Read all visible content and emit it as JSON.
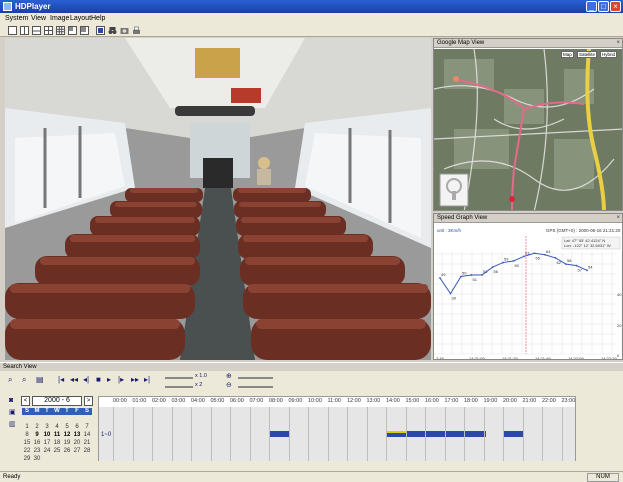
{
  "window": {
    "title": "HDPlayer",
    "minimize": "_",
    "maximize": "□",
    "close": "×"
  },
  "menu": [
    "System",
    "View",
    "Image",
    "Layout",
    "Help"
  ],
  "map": {
    "title": "Google Map View",
    "buttons": [
      "Map",
      "Satellite",
      "Hybrid"
    ]
  },
  "speed": {
    "title": "Speed Graph View",
    "unit_label": "unit : 3Km/h",
    "gps_label": "GPS (GMT+0) : 2000-06-16 21:21:20",
    "lat_label": "Lat: 47° 55' 42.4124\" N",
    "lon_label": "Lon: -122° 12' 32.6031\" W",
    "point_labels": [
      "49",
      "39",
      "50",
      "51",
      "51",
      "56",
      "59",
      "60",
      "63",
      "65",
      "64",
      "62",
      "58",
      "57",
      "54"
    ],
    "x_ticks": [
      "2:48",
      "14:21:09",
      "14:21:29",
      "14:21:49",
      "14:22:09",
      "14:22:29"
    ],
    "y_ticks": [
      "40",
      "20",
      "0"
    ]
  },
  "search": {
    "title": "Search View",
    "speed_top": "x 1.0",
    "speed_bottom": "x 2",
    "calendar": {
      "month": "2000 - 6",
      "prev": "<",
      "next": ">",
      "days": [
        "S",
        "M",
        "T",
        "W",
        "T",
        "F",
        "S"
      ],
      "rows": [
        [
          "",
          "",
          "",
          "",
          "",
          "",
          ""
        ],
        [
          "1",
          "2",
          "3",
          "4",
          "5",
          "6",
          "7"
        ],
        [
          "8",
          "9",
          "10",
          "11",
          "12",
          "13",
          "14"
        ],
        [
          "15",
          "16",
          "17",
          "18",
          "19",
          "20",
          "21"
        ],
        [
          "22",
          "23",
          "24",
          "25",
          "26",
          "27",
          "28"
        ],
        [
          "29",
          "30",
          "",
          "",
          "",
          "",
          ""
        ]
      ]
    },
    "channel": "1~0",
    "hours": [
      "00:00",
      "01:00",
      "02:00",
      "03:00",
      "04:00",
      "05:00",
      "06:00",
      "07:00",
      "08:00",
      "09:00",
      "10:00",
      "11:00",
      "12:00",
      "13:00",
      "14:00",
      "15:00",
      "16:00",
      "17:00",
      "18:00",
      "19:00",
      "20:00",
      "21:00",
      "22:00",
      "23:00"
    ]
  },
  "status": {
    "left": "Ready",
    "right": "NUM"
  }
}
